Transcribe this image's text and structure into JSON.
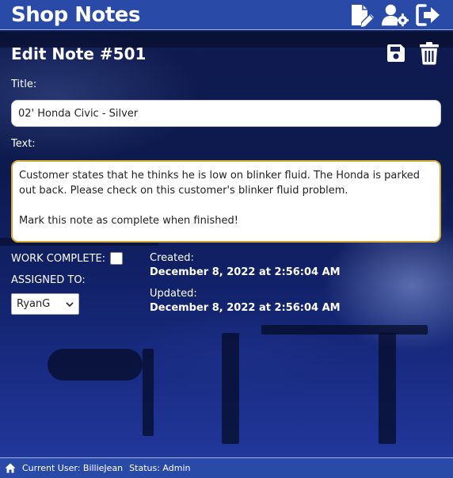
{
  "app": {
    "brand": "Shop Notes"
  },
  "header": {
    "icons": [
      "edit-note-icon",
      "user-settings-icon",
      "logout-icon"
    ]
  },
  "page": {
    "title": "Edit Note #501",
    "actions": [
      "save-icon",
      "trash-icon"
    ]
  },
  "form": {
    "title_label": "Title:",
    "title_value": "02' Honda Civic - Silver",
    "text_label": "Text:",
    "text_value": "Customer states that he thinks he is low on blinker fluid. The Honda is parked out back. Please check on this customer's blinker fluid problem.\n\nMark this note as complete when finished!",
    "work_complete_label": "WORK COMPLETE:",
    "work_complete_checked": false,
    "assigned_label": "ASSIGNED TO:",
    "assigned_value": "RyanG"
  },
  "meta": {
    "created_label": "Created:",
    "created_value": "December 8, 2022 at 2:56:04 AM",
    "updated_label": "Updated:",
    "updated_value": "December 8, 2022 at 2:56:04 AM"
  },
  "footer": {
    "current_user": "Current User: BillieJean",
    "status": "Status: Admin"
  },
  "colors": {
    "header_bg": "#2a4aa8",
    "textarea_focus_border": "#d7a736",
    "text": "#ffffff"
  }
}
